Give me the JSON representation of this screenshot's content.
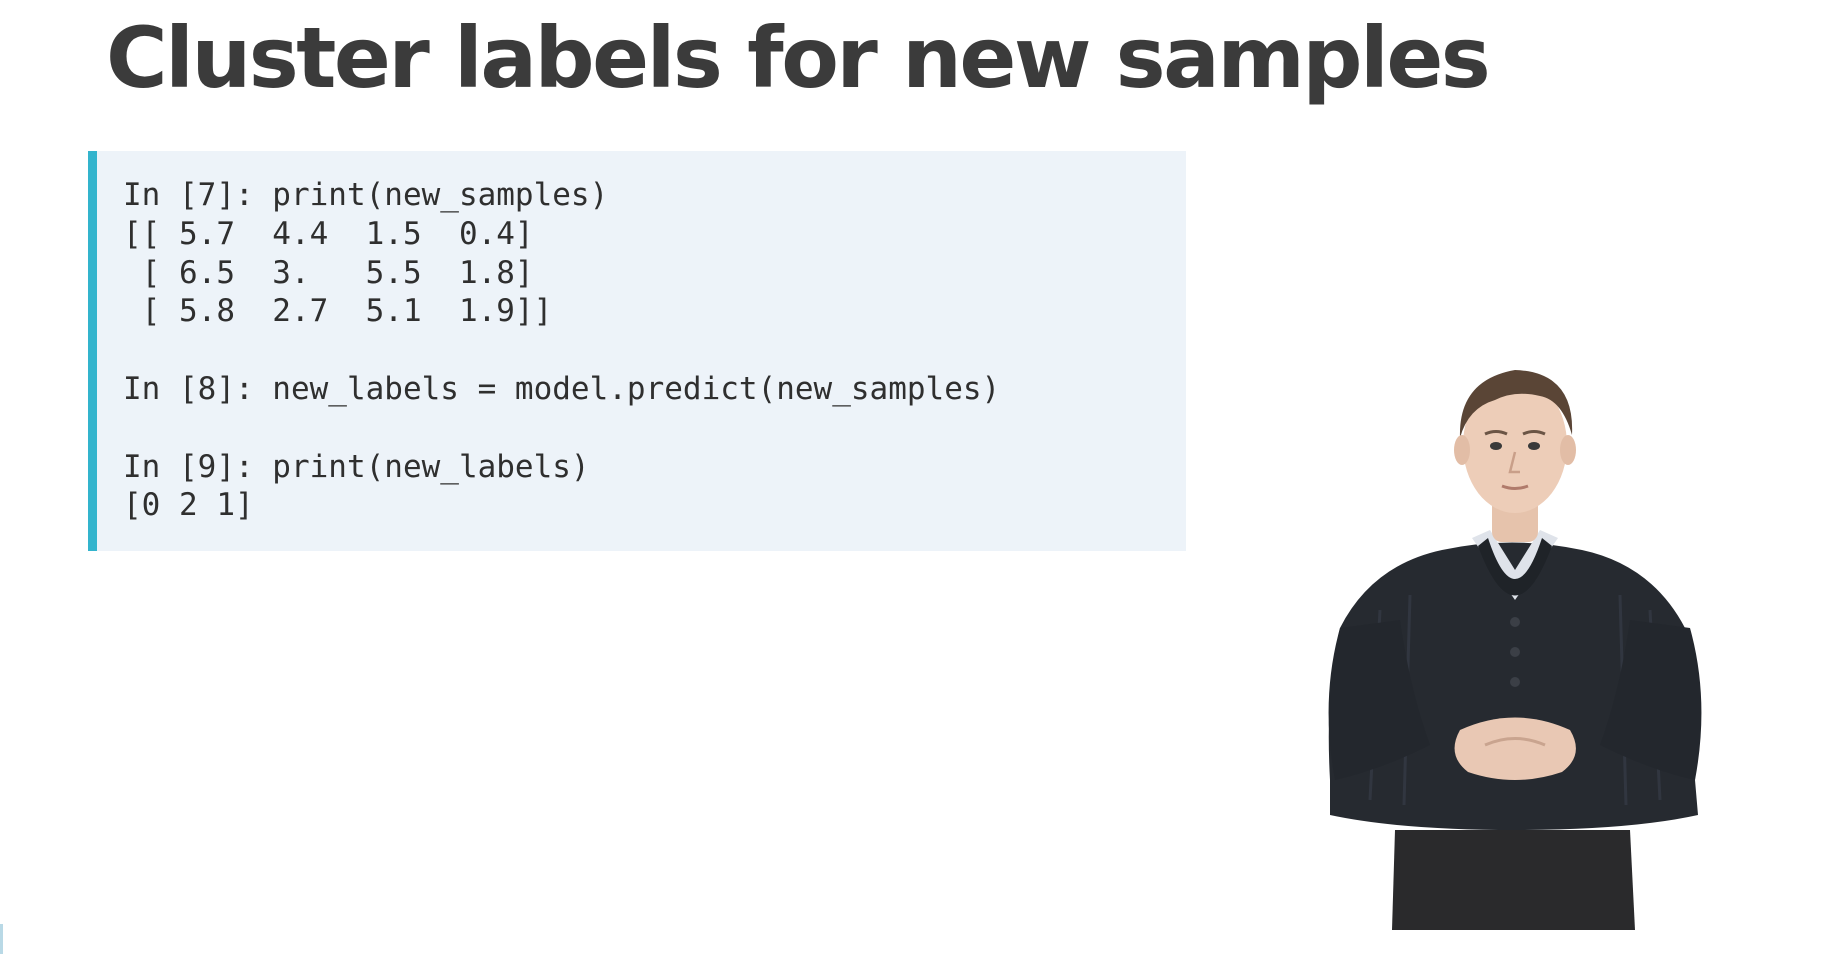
{
  "slide": {
    "title": "Cluster labels for new samples"
  },
  "code": {
    "lines": [
      "In [7]: print(new_samples)",
      "[[ 5.7  4.4  1.5  0.4]",
      " [ 6.5  3.   5.5  1.8]",
      " [ 5.8  2.7  5.1  1.9]]",
      "",
      "In [8]: new_labels = model.predict(new_samples)",
      "",
      "In [9]: print(new_labels)",
      "[0 2 1]"
    ]
  },
  "colors": {
    "title": "#3b3b3b",
    "code_background": "#edf3f9",
    "code_accent_bar": "#33b4cd",
    "code_text": "#2f2f2f"
  },
  "presenter": {
    "icon": "presenter-figure"
  }
}
